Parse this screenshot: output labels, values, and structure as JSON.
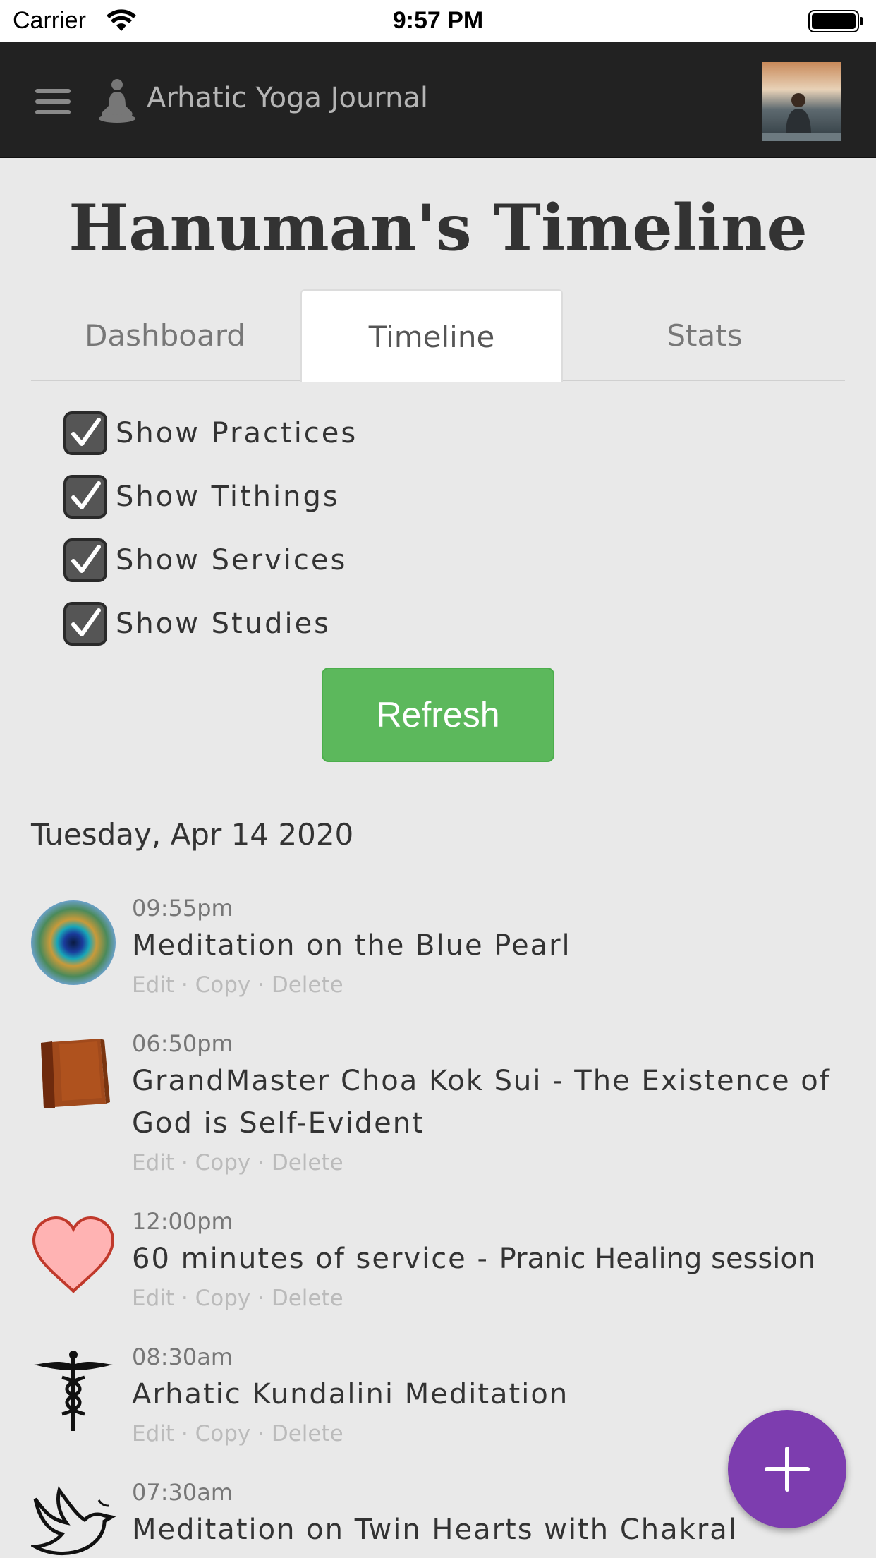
{
  "status_bar": {
    "carrier": "Carrier",
    "time": "9:57 PM"
  },
  "navbar": {
    "brand": "Arhatic Yoga Journal"
  },
  "page": {
    "title": "Hanuman's Timeline"
  },
  "tabs": [
    {
      "label": "Dashboard",
      "active": false
    },
    {
      "label": "Timeline",
      "active": true
    },
    {
      "label": "Stats",
      "active": false
    }
  ],
  "filters": [
    {
      "label": "Show Practices",
      "checked": true
    },
    {
      "label": "Show Tithings",
      "checked": true
    },
    {
      "label": "Show Services",
      "checked": true
    },
    {
      "label": "Show Studies",
      "checked": true
    }
  ],
  "refresh_label": "Refresh",
  "date_heading": "Tuesday, Apr 14 2020",
  "entries": [
    {
      "time": "09:55pm",
      "title": "Meditation on the Blue Pearl",
      "subtitle": "",
      "icon": "peacock-feather-icon"
    },
    {
      "time": "06:50pm",
      "title": "GrandMaster Choa Kok Sui - The Existence of God is Self-Evident",
      "subtitle": "",
      "icon": "book-icon"
    },
    {
      "time": "12:00pm",
      "title": "60 minutes of service -",
      "subtitle": "Pranic Healing session",
      "icon": "heart-icon"
    },
    {
      "time": "08:30am",
      "title": "Arhatic Kundalini Meditation",
      "subtitle": "",
      "icon": "caduceus-icon"
    },
    {
      "time": "07:30am",
      "title": "Meditation on Twin Hearts with Chakral",
      "subtitle": "",
      "icon": "dove-icon"
    }
  ],
  "actions": {
    "edit": "Edit",
    "copy": "Copy",
    "delete": "Delete",
    "separator": "·"
  },
  "colors": {
    "accent_green": "#5cb85c",
    "fab_purple": "#7d3daf",
    "navbar_bg": "#222222"
  }
}
